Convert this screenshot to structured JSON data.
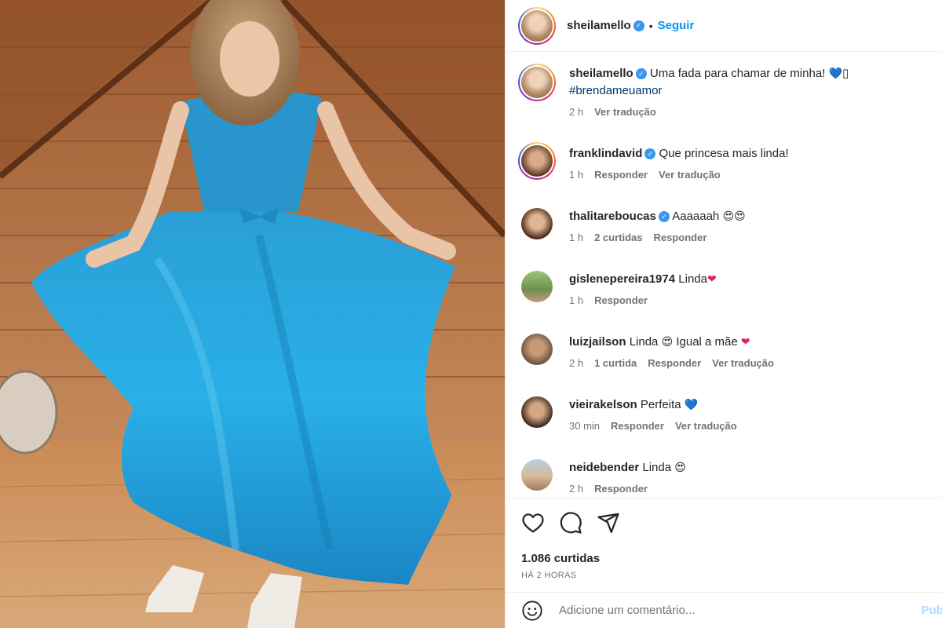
{
  "post": {
    "author": "sheilamello",
    "follow_label": "Seguir",
    "dot": "•"
  },
  "comments": [
    {
      "username": "sheilamello",
      "verified": true,
      "text": "Uma fada para chamar de minha!",
      "emoji": "💙",
      "extra": "▯",
      "hashtag": "#brendameuamor",
      "time": "2 h",
      "likes": "",
      "reply": "",
      "translate": "Ver tradução"
    },
    {
      "username": "franklindavid",
      "verified": true,
      "text": "Que princesa mais linda!",
      "time": "1 h",
      "reply": "Responder",
      "translate": "Ver tradução"
    },
    {
      "username": "thalitareboucas",
      "verified": true,
      "text": "Aaaaaah",
      "emoji": "😍😍",
      "time": "1 h",
      "likes": "2 curtidas",
      "reply": "Responder"
    },
    {
      "username": "gislenepereira1974",
      "verified": false,
      "text": "Linda",
      "emoji": "❤",
      "time": "1 h",
      "reply": "Responder"
    },
    {
      "username": "luizjailson",
      "verified": false,
      "text": "Linda",
      "emoji": "😍",
      "text2": "Igual a mãe",
      "emoji2": "❤",
      "time": "2 h",
      "likes": "1 curtida",
      "reply": "Responder",
      "translate": "Ver tradução"
    },
    {
      "username": "vieirakelson",
      "verified": false,
      "text": "Perfeita",
      "emoji": "💙",
      "time": "30 min",
      "reply": "Responder",
      "translate": "Ver tradução"
    },
    {
      "username": "neidebender",
      "verified": false,
      "text": "Linda",
      "emoji": "😍",
      "time": "2 h",
      "reply": "Responder"
    }
  ],
  "actions": {
    "like_icon": "heart-outline-icon",
    "comment_icon": "comment-bubble-icon",
    "share_icon": "paper-plane-icon"
  },
  "stats": {
    "likes": "1.086 curtidas",
    "time_ago": "HÁ 2 HORAS"
  },
  "composer": {
    "placeholder": "Adicione um comentário...",
    "publish": "Publ"
  },
  "colors": {
    "accent": "#0095f6",
    "verified": "#3897f0",
    "text_muted": "#737373",
    "dress_blue": "#1fa3d8"
  }
}
